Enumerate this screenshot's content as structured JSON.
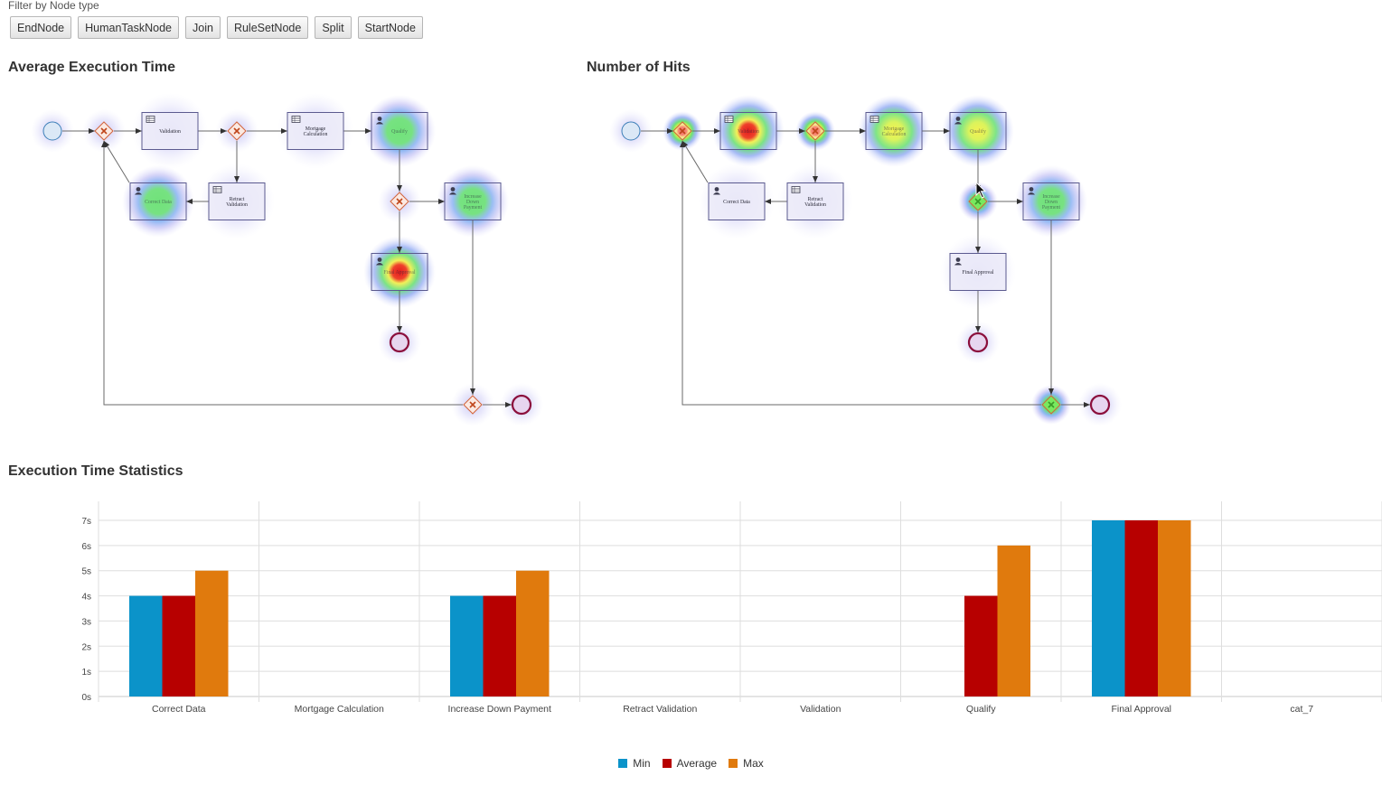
{
  "filter": {
    "label": "Filter by Node type",
    "buttons": [
      "EndNode",
      "HumanTaskNode",
      "Join",
      "RuleSetNode",
      "Split",
      "StartNode"
    ]
  },
  "sections": {
    "avg_title": "Average Execution Time",
    "hits_title": "Number of Hits",
    "stats_title": "Execution Time Statistics"
  },
  "diagram_labels": {
    "validation": "Validation",
    "mortgage_calc": [
      "Mortgage",
      "Calculation"
    ],
    "qualify": "Qualify",
    "correct_data": "Correct Data",
    "retract_validation": [
      "Retract",
      "Validation"
    ],
    "increase_down_payment": [
      "Increase",
      "Down",
      "Payment"
    ],
    "final_approval": "Final Approval"
  },
  "heat": {
    "avg": {
      "correct_data": "green",
      "qualify": "green",
      "increase_down_payment": "green",
      "final_approval": "red"
    },
    "hits": {
      "split_1": "red",
      "validation": "red",
      "split_2": "red",
      "mortgage_calc": "yellow",
      "qualify": "yellow",
      "split_3": "green",
      "increase_down_payment": "green",
      "join_1": "green"
    }
  },
  "colors": {
    "min": "#0b93c9",
    "average": "#b70000",
    "max": "#e07a0d",
    "gateway": "#d2633a",
    "end_event": "#8b0f3c",
    "node_fill": "#ecebf8",
    "node_stroke": "#5b5a8f"
  },
  "chart_data": {
    "type": "bar",
    "categories": [
      "Correct Data",
      "Mortgage Calculation",
      "Increase Down Payment",
      "Retract Validation",
      "Validation",
      "Qualify",
      "Final Approval",
      "cat_7"
    ],
    "series": [
      {
        "name": "Min",
        "values": [
          4,
          0,
          4,
          0,
          0,
          0,
          7,
          0
        ]
      },
      {
        "name": "Average",
        "values": [
          4,
          0,
          4,
          0,
          0,
          4,
          7,
          0
        ]
      },
      {
        "name": "Max",
        "values": [
          5,
          0,
          5,
          0,
          0,
          6,
          7,
          0
        ]
      }
    ],
    "y_ticks": [
      "0s",
      "1s",
      "2s",
      "3s",
      "4s",
      "5s",
      "6s",
      "7s"
    ],
    "ylim": [
      0,
      7
    ],
    "grid": true,
    "legend_position": "bottom-center",
    "title": "Execution Time Statistics"
  }
}
